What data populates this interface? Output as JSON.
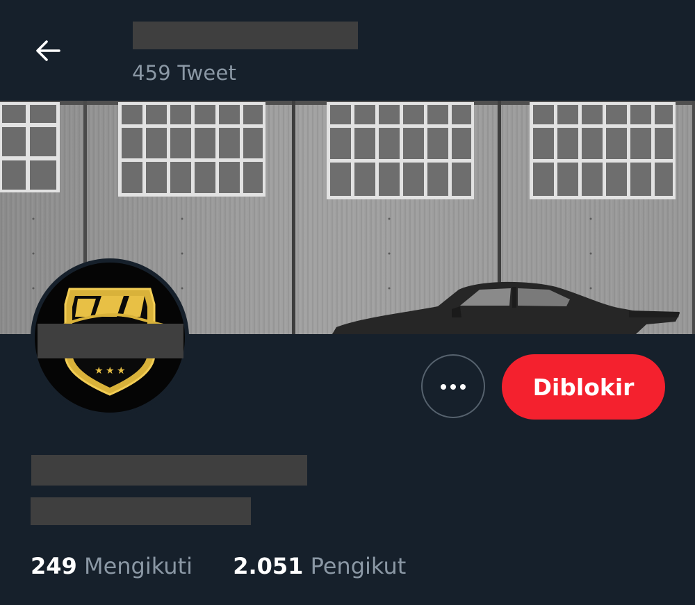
{
  "header": {
    "back_icon": "arrow-left-icon",
    "tweet_count": "459 Tweet"
  },
  "profile": {
    "banner_image": "grayscale hangar wall with windows and classic car",
    "avatar": "gold car emblem shield logo",
    "name_redacted": true,
    "handle_redacted": true
  },
  "actions": {
    "more_icon": "more-horizontal-icon",
    "blocked_label": "Diblokir",
    "blocked_color": "#f4212e"
  },
  "stats": {
    "following_count": "249",
    "following_label": "Mengikuti",
    "followers_count": "2.051",
    "followers_label": "Pengikut"
  },
  "colors": {
    "background": "#16202b",
    "secondary_text": "#8b98a5",
    "accent_red": "#f4212e"
  }
}
